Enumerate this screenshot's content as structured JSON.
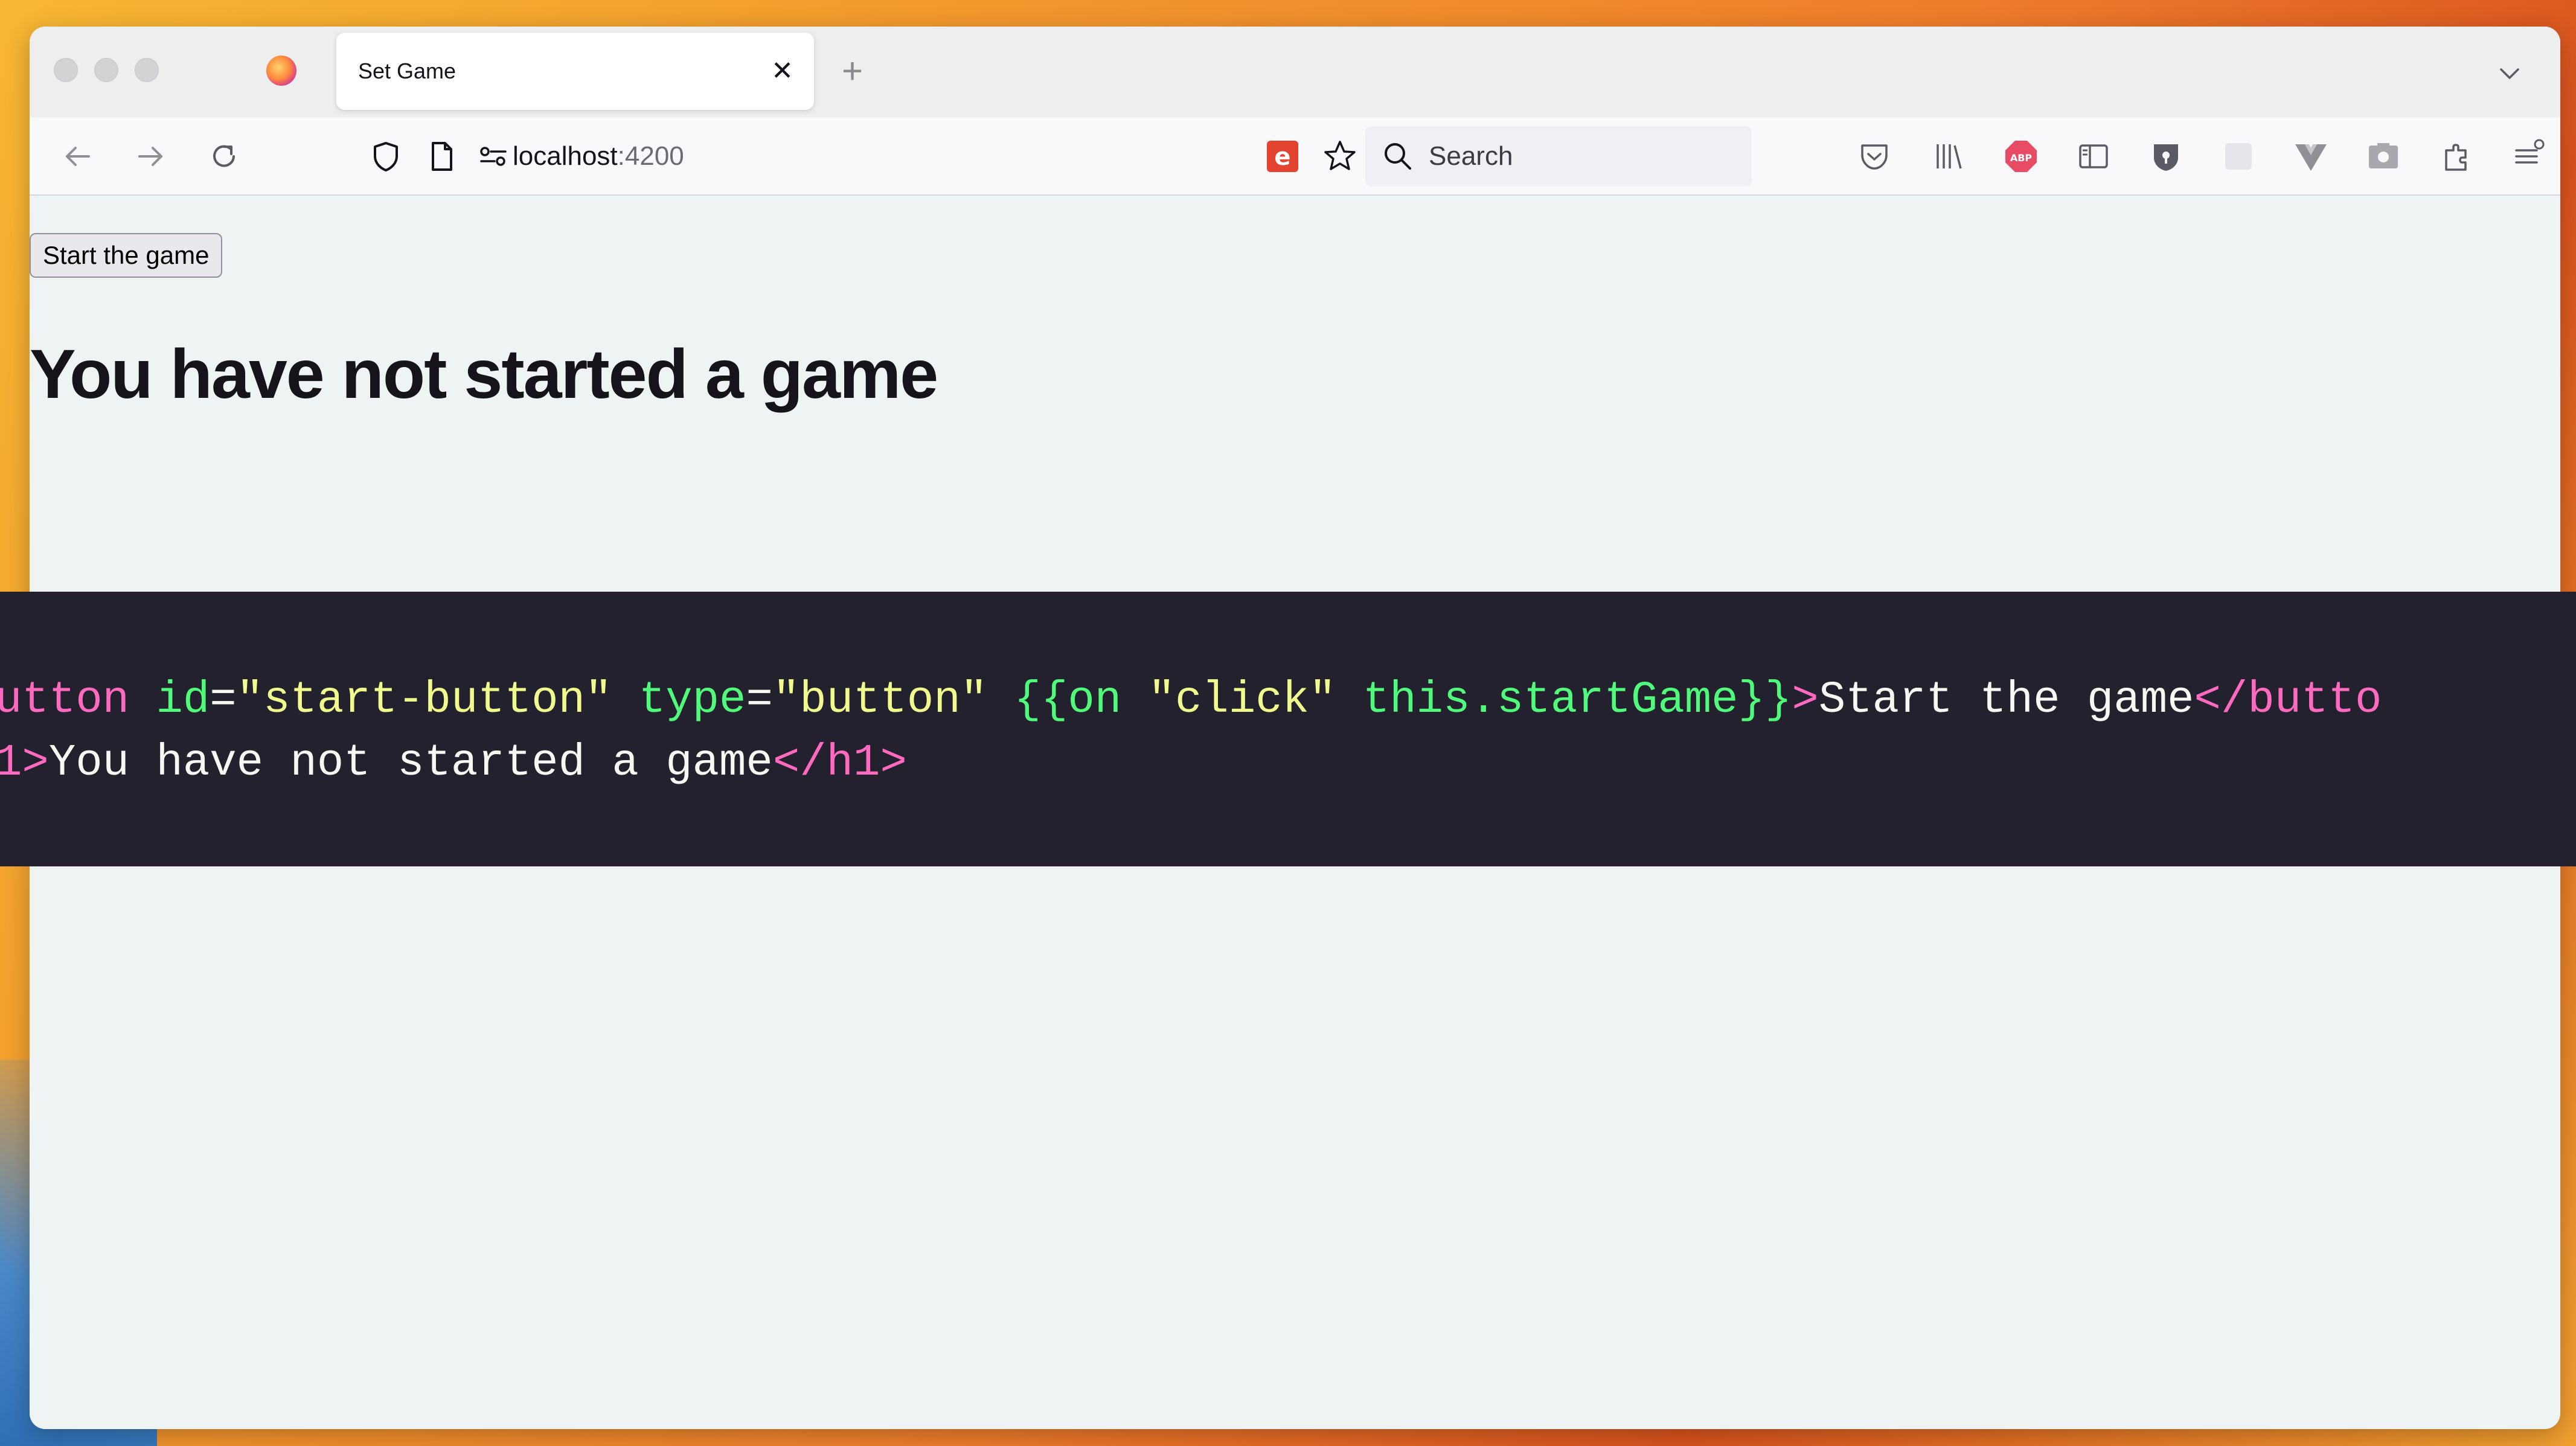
{
  "browser": {
    "tab": {
      "title": "Set Game"
    },
    "url": {
      "host": "localhost",
      "port": ":4200"
    },
    "search": {
      "placeholder": "Search"
    }
  },
  "page": {
    "start_button": "Start the game",
    "heading": "You have not started a game"
  },
  "code_overlay": {
    "line1": {
      "tag_open": "utton",
      "attr_id": " id",
      "eq1": "=",
      "id_val": "\"start-button\"",
      "attr_type": " type",
      "eq2": "=",
      "type_val": "\"button\"",
      "handlebars_open": " {{on ",
      "click_str": "\"click\"",
      "handlebars_rest": " this.startGame}}",
      "gt": ">",
      "text": "Start the game",
      "close_tag": "</butto"
    },
    "line2": {
      "tag_tail": "1>",
      "text": "You have not started a game",
      "close_tag": "</h1>"
    }
  }
}
